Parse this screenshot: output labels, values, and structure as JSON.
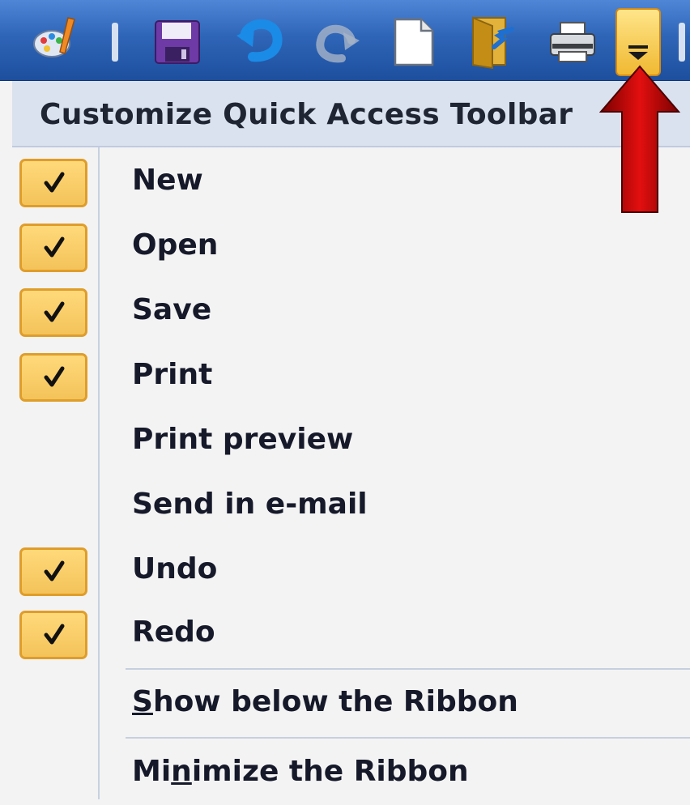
{
  "toolbar": {
    "buttons": [
      {
        "name": "paint-icon"
      },
      {
        "name": "save-icon"
      },
      {
        "name": "undo-icon"
      },
      {
        "name": "redo-icon"
      },
      {
        "name": "new-document-icon"
      },
      {
        "name": "open-folder-icon"
      },
      {
        "name": "print-icon"
      }
    ],
    "dropdown_icon": "chevron-down-icon",
    "colors": {
      "bar": "#2f65b7",
      "highlight": "#f0b932"
    }
  },
  "menu": {
    "title": "Customize Quick Access Toolbar",
    "items": [
      {
        "label": "New",
        "checked": true
      },
      {
        "label": "Open",
        "checked": true
      },
      {
        "label": "Save",
        "checked": true
      },
      {
        "label": "Print",
        "checked": true
      },
      {
        "label": "Print preview",
        "checked": false
      },
      {
        "label": "Send in e-mail",
        "checked": false
      },
      {
        "label": "Undo",
        "checked": true
      },
      {
        "label": "Redo",
        "checked": true
      }
    ],
    "show_below": {
      "before": "",
      "underlined": "S",
      "after": "how below the Ribbon"
    },
    "minimize": {
      "before": "Mi",
      "underlined": "n",
      "after": "imize the Ribbon"
    }
  },
  "annotation": {
    "arrow_color": "#d10a0a"
  }
}
